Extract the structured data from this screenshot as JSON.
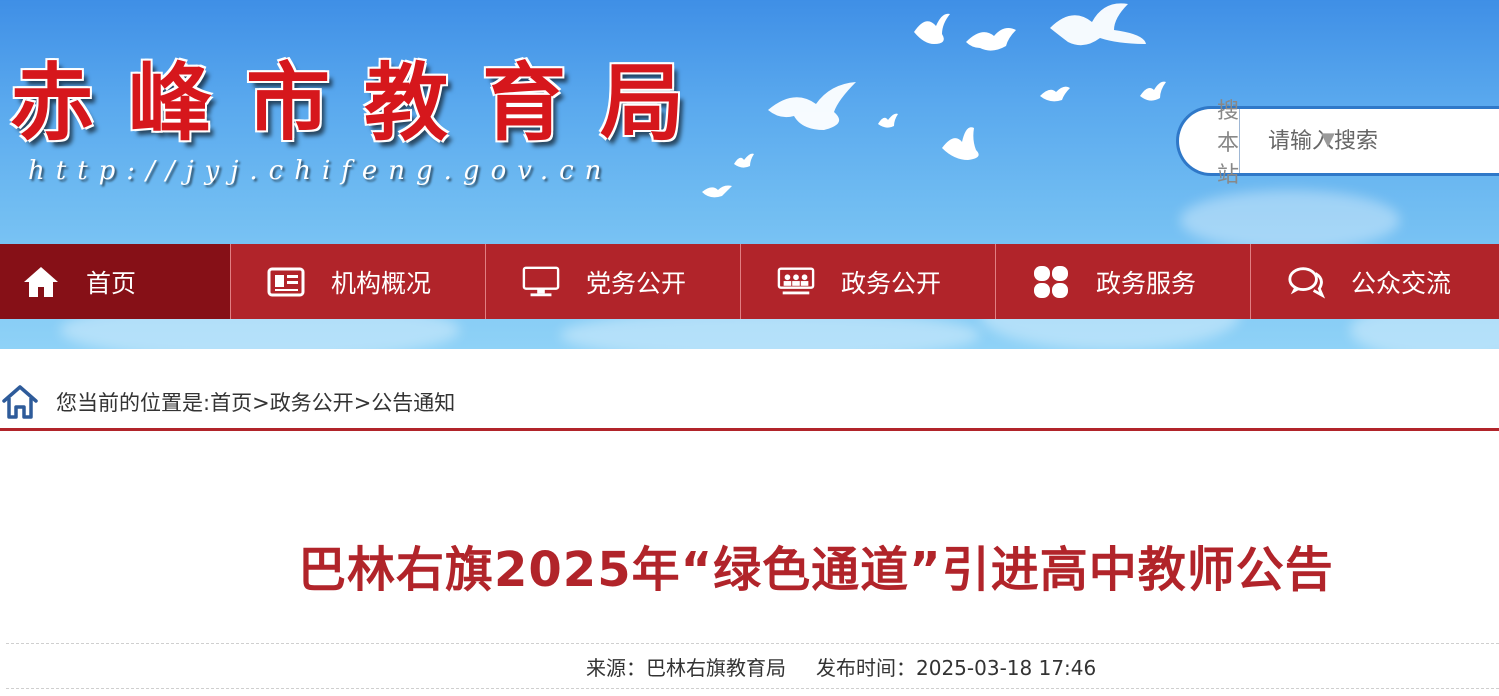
{
  "header": {
    "site_name": "赤峰市教育局",
    "site_url": "http://jyj.chifeng.gov.cn"
  },
  "search": {
    "scope_label": "搜本站",
    "placeholder": "请输入搜索"
  },
  "nav": {
    "items": [
      {
        "label": "首页",
        "icon": "home-icon"
      },
      {
        "label": "机构概况",
        "icon": "newspaper-icon"
      },
      {
        "label": "党务公开",
        "icon": "monitor-icon"
      },
      {
        "label": "政务公开",
        "icon": "meeting-icon"
      },
      {
        "label": "政务服务",
        "icon": "clover-icon"
      },
      {
        "label": "公众交流",
        "icon": "chat-icon"
      }
    ]
  },
  "breadcrumb": {
    "prefix": "您当前的位置是:",
    "items": [
      "首页",
      "政务公开",
      "公告通知"
    ],
    "separator": ">"
  },
  "article": {
    "title": "巴林右旗2025年“绿色通道”引进高中教师公告",
    "source_label": "来源：",
    "source": "巴林右旗教育局",
    "time_label": "发布时间：",
    "time": "2025-03-18 17:46"
  },
  "colors": {
    "brand_red": "#b1242a",
    "nav_active": "#861017",
    "sky_blue": "#5aa9ee"
  }
}
